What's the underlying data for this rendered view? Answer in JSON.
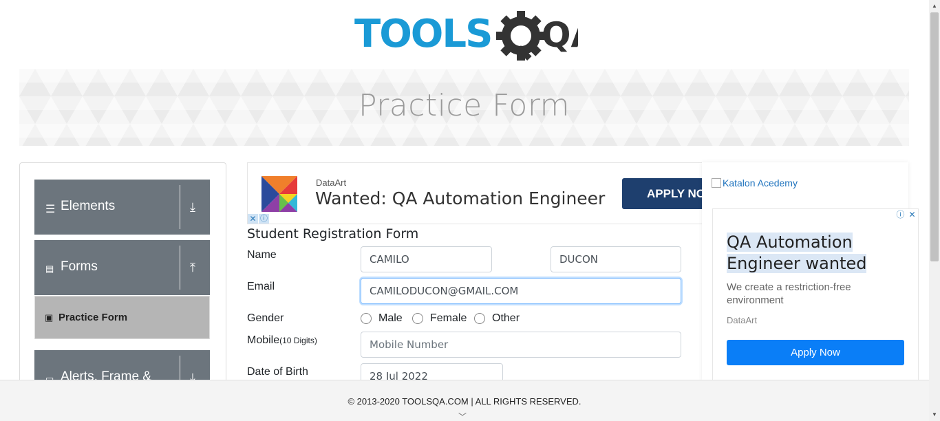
{
  "header": {
    "logo_text_left": "TOOLS",
    "logo_text_right": "QA",
    "colors": {
      "logo_blue": "#1a9ad6",
      "logo_dark": "#333333"
    }
  },
  "banner": {
    "title": "Practice Form"
  },
  "sidebar": {
    "groups": [
      {
        "label": "Elements",
        "icon": "hamburger-icon",
        "arrow": "download-icon"
      },
      {
        "label": "Forms",
        "icon": "document-icon",
        "arrow": "upload-icon"
      },
      {
        "label": "Alerts, Frame &",
        "icon": "window-icon",
        "arrow": "download-icon"
      }
    ],
    "active_item": {
      "label": "Practice Form",
      "icon": "form-icon"
    }
  },
  "ad_top": {
    "brand": "DataArt",
    "headline": "Wanted: QA Automation Engineer",
    "button": "APPLY NOW"
  },
  "form": {
    "title": "Student Registration Form",
    "name_label": "Name",
    "first_name": "CAMILO",
    "last_name": "DUCON",
    "email_label": "Email",
    "email": "CAMILODUCON@GMAIL.COM",
    "gender_label": "Gender",
    "genders": [
      "Male",
      "Female",
      "Other"
    ],
    "mobile_label": "Mobile",
    "mobile_hint": "(10 Digits)",
    "mobile_placeholder": "Mobile Number",
    "dob_label": "Date of Birth",
    "dob": "28 Jul 2022"
  },
  "ad_right": {
    "link_text": "Katalon Acedemy",
    "headline_1": "QA Automation",
    "headline_2": "Engineer wanted",
    "description": "We create a restriction-free environment",
    "brand": "DataArt",
    "button": "Apply Now"
  },
  "footer": {
    "copyright": "© 2013-2020 TOOLSQA.COM | ALL RIGHTS RESERVED."
  }
}
